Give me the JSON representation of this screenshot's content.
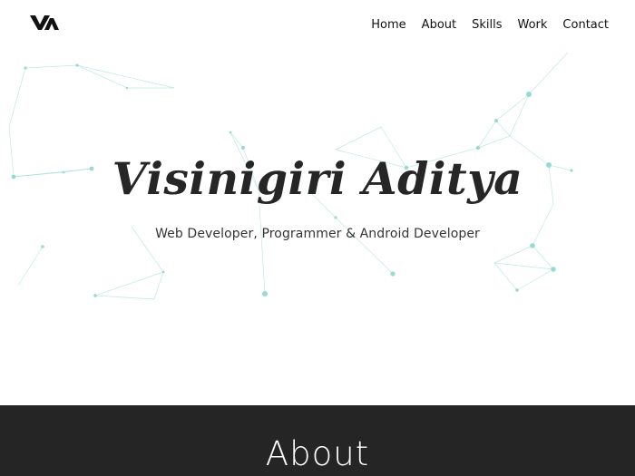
{
  "header": {
    "logo_icon": "va-logo-icon",
    "nav": {
      "home": "Home",
      "about": "About",
      "skills": "Skills",
      "work": "Work",
      "contact": "Contact"
    }
  },
  "hero": {
    "title": "Visinigiri Aditya",
    "subtitle": "Web Developer, Programmer & Android Developer",
    "background": "particle-network",
    "accent_color": "#8fd6cf"
  },
  "about": {
    "heading": "About",
    "background_color": "#252525"
  }
}
